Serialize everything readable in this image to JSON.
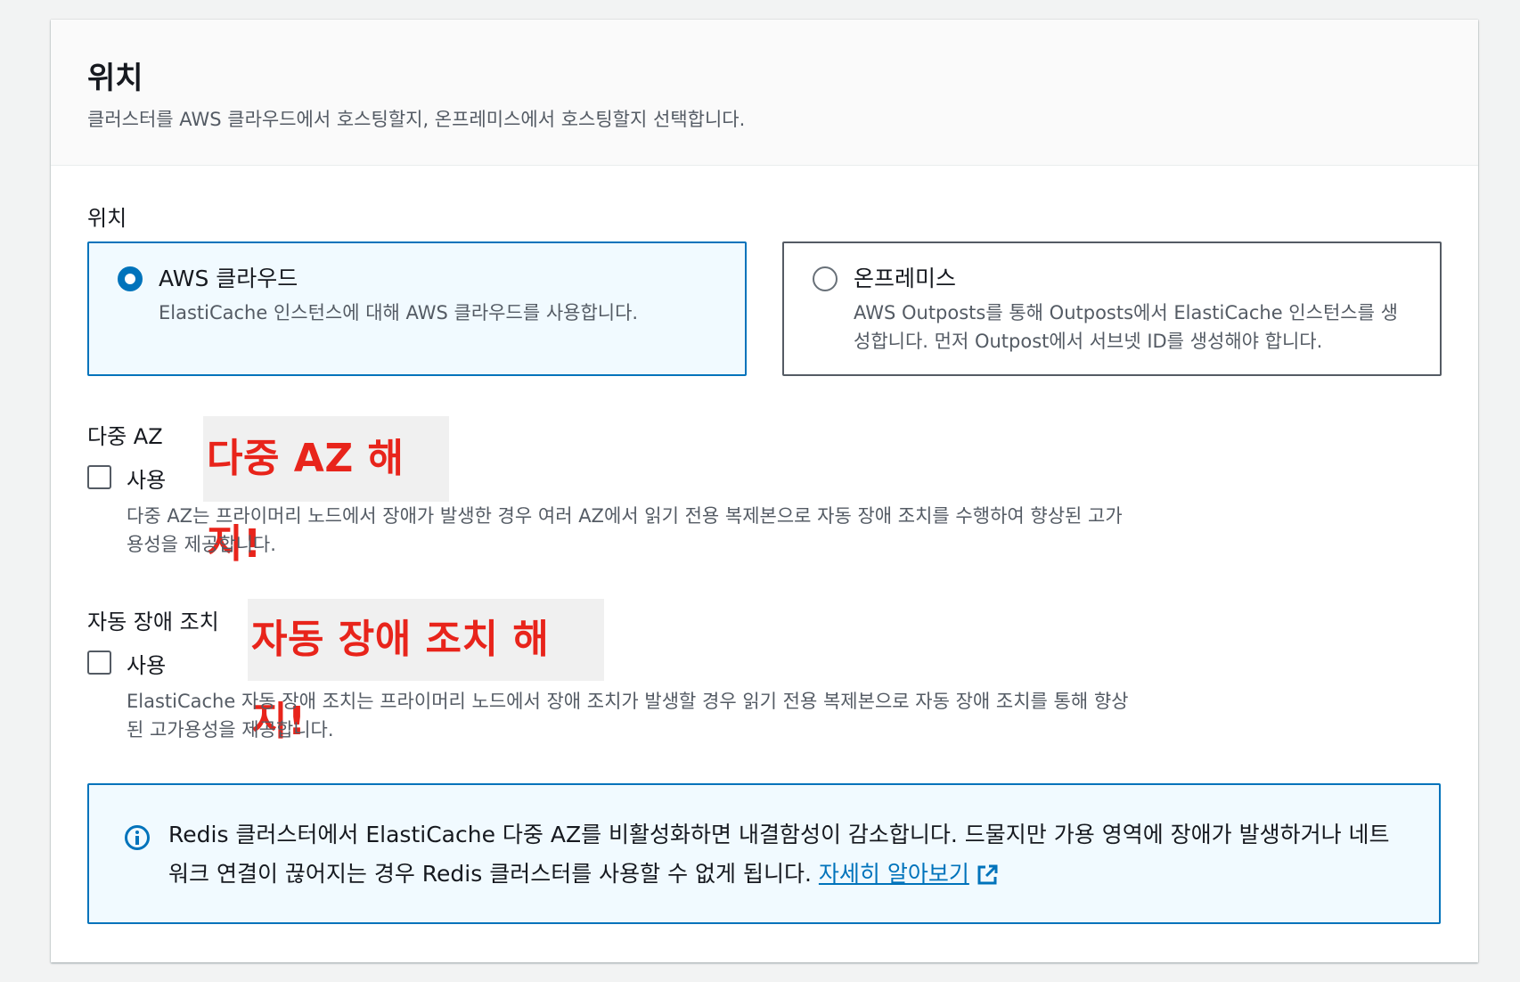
{
  "panel": {
    "title": "위치",
    "description": "클러스터를 AWS 클라우드에서 호스팅할지, 온프레미스에서 호스팅할지 선택합니다."
  },
  "location": {
    "label": "위치",
    "options": [
      {
        "label": "AWS 클라우드",
        "description": "ElastiCache 인스턴스에 대해 AWS 클라우드를 사용합니다.",
        "selected": true
      },
      {
        "label": "온프레미스",
        "description": "AWS Outposts를 통해 Outposts에서 ElastiCache 인스턴스를 생성합니다. 먼저 Outpost에서 서브넷 ID를 생성해야 합니다.",
        "selected": false
      }
    ]
  },
  "multi_az": {
    "label": "다중 AZ",
    "annotation": "다중 AZ 해지!",
    "checkbox_label": "사용",
    "checked": false,
    "description": "다중 AZ는 프라이머리 노드에서 장애가 발생한 경우 여러 AZ에서 읽기 전용 복제본으로 자동 장애 조치를 수행하여 향상된 고가용성을 제공합니다."
  },
  "auto_failover": {
    "label": "자동 장애 조치",
    "annotation": "자동 장애 조치 해지!",
    "checkbox_label": "사용",
    "checked": false,
    "description": "ElastiCache 자동 장애 조치는 프라이머리 노드에서 장애 조치가 발생할 경우 읽기 전용 복제본으로 자동 장애 조치를 통해 향상된 고가용성을 제공합니다."
  },
  "alert": {
    "icon": "info-icon",
    "text": "Redis 클러스터에서 ElastiCache 다중 AZ를 비활성화하면 내결함성이 감소합니다. 드물지만 가용 영역에 장애가 발생하거나 네트워크 연결이 끊어지는 경우 Redis 클러스터를 사용할 수 없게 됩니다. ",
    "link_label": "자세히 알아보기",
    "link_icon": "external-link-icon"
  },
  "colors": {
    "accent": "#0073bb",
    "annotation": "#e8241b",
    "text": "#16191f",
    "secondary_text": "#545b64"
  }
}
